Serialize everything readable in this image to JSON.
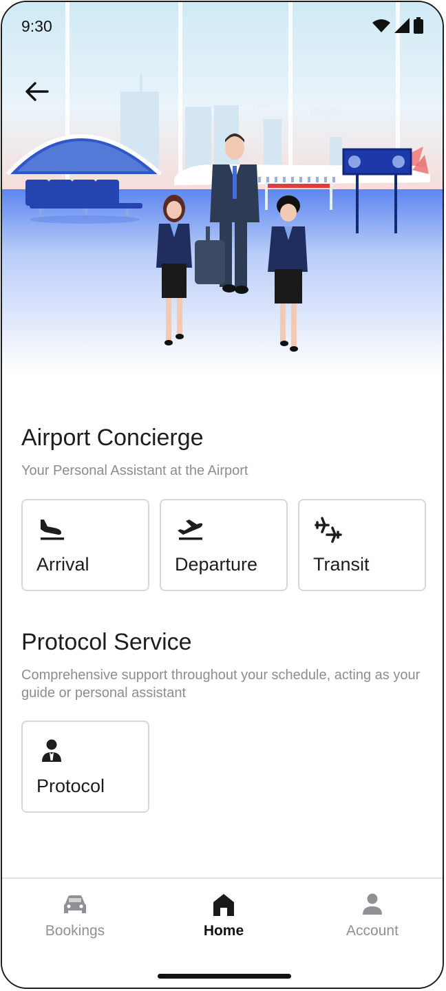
{
  "status_bar": {
    "time": "9:30"
  },
  "airport_concierge": {
    "title": "Airport Concierge",
    "subtitle": "Your Personal Assistant at the Airport",
    "cards": [
      {
        "label": "Arrival",
        "icon": "flight-land-icon"
      },
      {
        "label": "Departure",
        "icon": "flight-takeoff-icon"
      },
      {
        "label": "Transit",
        "icon": "connecting-flights-icon"
      }
    ]
  },
  "protocol_service": {
    "title": "Protocol Service",
    "subtitle": "Comprehensive support throughout your schedule, acting as your guide or personal assistant",
    "cards": [
      {
        "label": "Protocol",
        "icon": "person-suit-icon"
      }
    ]
  },
  "bottom_nav": {
    "items": [
      {
        "label": "Bookings",
        "icon": "car-icon",
        "active": false
      },
      {
        "label": "Home",
        "icon": "home-icon",
        "active": true
      },
      {
        "label": "Account",
        "icon": "person-icon",
        "active": false
      }
    ]
  },
  "colors": {
    "accent_navy": "#1f2e5e",
    "text_primary": "#1d1d1f",
    "text_secondary": "#8a8d93",
    "card_border": "#d6d7da"
  }
}
